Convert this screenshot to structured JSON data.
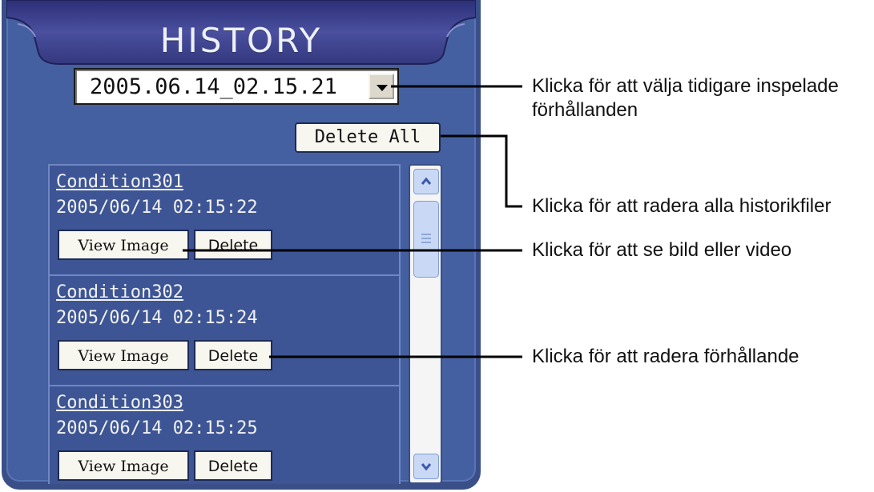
{
  "panel": {
    "title": "HISTORY",
    "dropdown_value": "2005.06.14_02.15.21",
    "delete_all_label": "Delete All"
  },
  "items": [
    {
      "name": "Condition301",
      "date": "2005/06/14 02:15:22",
      "view_label": "View Image",
      "delete_label": "Delete"
    },
    {
      "name": "Condition302",
      "date": "2005/06/14 02:15:24",
      "view_label": "View Image",
      "delete_label": "Delete"
    },
    {
      "name": "Condition303",
      "date": "2005/06/14 02:15:25",
      "view_label": "View Image",
      "delete_label": "Delete"
    }
  ],
  "annotations": {
    "select_previous": "Klicka för att välja tidigare inspelade förhållanden",
    "delete_all": "Klicka för att radera alla historikfiler",
    "view_image": "Klicka för att se bild eller video",
    "delete_condition": "Klicka för att radera förhållande"
  },
  "colors": {
    "panel_bg": "#4560a0",
    "header_bg": "#3b3f8a",
    "item_bg": "#3d5594"
  }
}
